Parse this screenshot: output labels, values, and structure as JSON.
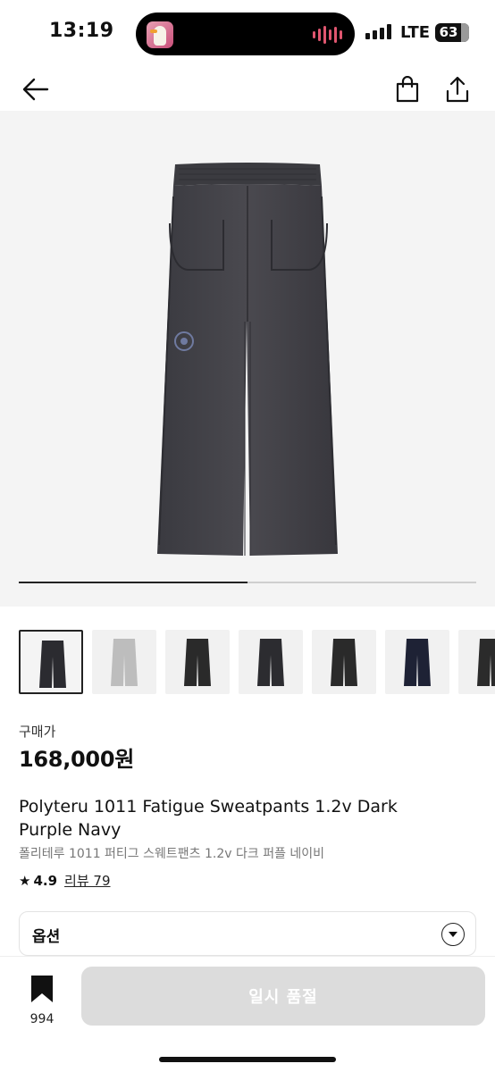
{
  "status_bar": {
    "time": "13:19",
    "network": "LTE",
    "battery": "63",
    "battery_level": 0.63
  },
  "nav": {
    "back_icon": "arrow-left-icon",
    "bag_icon": "shopping-bag-icon",
    "share_icon": "share-icon"
  },
  "gallery": {
    "progress": 0.5,
    "thumbnail_colors": [
      "#2b2b30",
      "#bdbdbd",
      "#2a2a2a",
      "#2c2c30",
      "#2a2a2a",
      "#1e2235",
      "#2b2b2b"
    ],
    "selected_index": 0
  },
  "price": {
    "label": "구매가",
    "value": "168,000원"
  },
  "product": {
    "name_en": "Polyteru 1011 Fatigue Sweatpants 1.2v Dark Purple Navy",
    "name_ko": "폴리테루 1011 퍼티그 스웨트팬츠 1.2v 다크 퍼플 네이비",
    "rating": "4.9",
    "review_label": "리뷰 79"
  },
  "options": {
    "label": "옵션"
  },
  "bottom_bar": {
    "wish_count": "994",
    "buy_label": "일시 품절"
  },
  "colors": {
    "accent": "#111111",
    "disabled_button": "#dcdcdc",
    "hero_bg": "#f4f4f4"
  }
}
